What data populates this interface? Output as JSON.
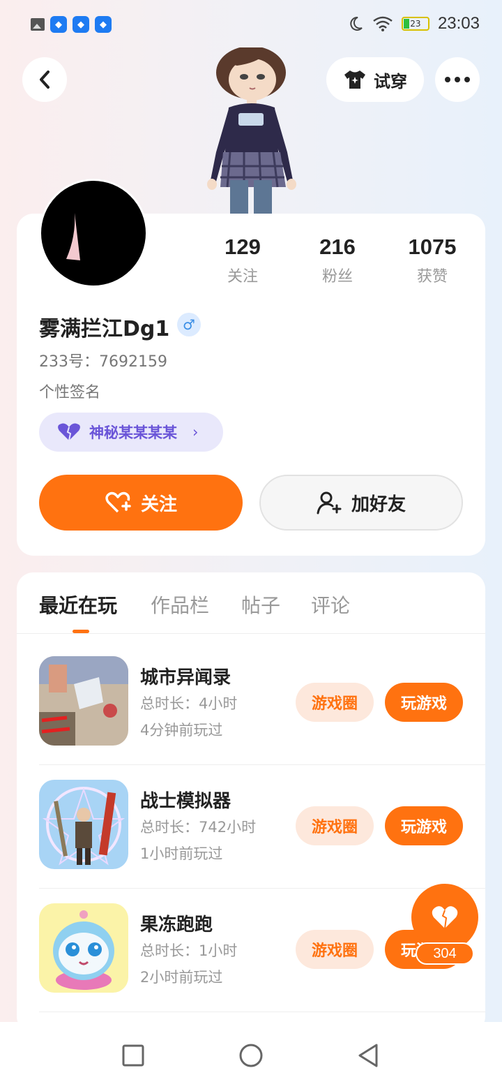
{
  "status_bar": {
    "time": "23:03",
    "battery": "23",
    "notification_icons": [
      "image-icon",
      "shield-app-icon",
      "shield-app-icon",
      "shield-app-icon"
    ],
    "system_icons": [
      "moon-icon",
      "wifi-icon",
      "battery-icon"
    ]
  },
  "header": {
    "try_on_label": "试穿"
  },
  "profile": {
    "stats": [
      {
        "value": "129",
        "label": "关注"
      },
      {
        "value": "216",
        "label": "粉丝"
      },
      {
        "value": "1075",
        "label": "获赞"
      }
    ],
    "username": "雾满拦江Dg1",
    "gender_symbol": "♂",
    "uid": "233号：7692159",
    "signature": "个性签名",
    "badge_label": "神秘某某某某",
    "follow_label": "关注",
    "add_friend_label": "加好友"
  },
  "tabs": [
    {
      "label": "最近在玩",
      "active": true
    },
    {
      "label": "作品栏",
      "active": false
    },
    {
      "label": "帖子",
      "active": false
    },
    {
      "label": "评论",
      "active": false
    }
  ],
  "games": [
    {
      "name": "城市异闻录",
      "duration": "总时长：4小时",
      "last_played": "4分钟前玩过",
      "circle_label": "游戏圈",
      "play_label": "玩游戏"
    },
    {
      "name": "战士模拟器",
      "duration": "总时长：742小时",
      "last_played": "1小时前玩过",
      "circle_label": "游戏圈",
      "play_label": "玩游戏"
    },
    {
      "name": "果冻跑跑",
      "duration": "总时长：1小时",
      "last_played": "2小时前玩过",
      "circle_label": "游戏圈",
      "play_label": "玩游戏"
    }
  ],
  "like_fab": {
    "count": "304"
  },
  "colors": {
    "accent": "#ff7210",
    "badge_bg": "#e9e8fb",
    "badge_text": "#6a55d8"
  }
}
